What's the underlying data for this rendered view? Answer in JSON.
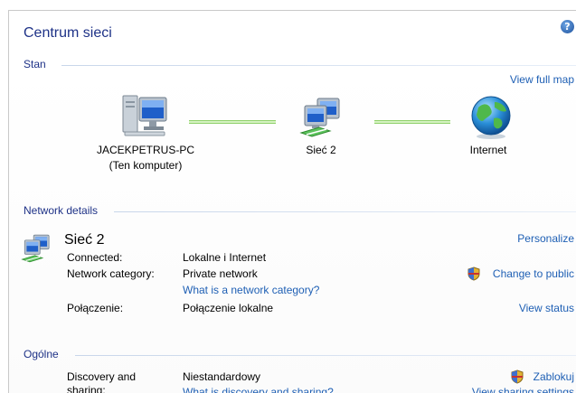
{
  "window": {
    "title": "Centrum sieci",
    "help_label": "?"
  },
  "status_section": {
    "heading": "Stan",
    "view_full_map": "View full map",
    "nodes": [
      {
        "name": "JACEKPETRUS-PC",
        "subtitle": "(Ten komputer)",
        "icon": "computer-icon"
      },
      {
        "name": "Sieć 2",
        "subtitle": "",
        "icon": "network-icon"
      },
      {
        "name": "Internet",
        "subtitle": "",
        "icon": "globe-icon"
      }
    ],
    "connection_color": "#8fd06a"
  },
  "network_details": {
    "heading": "Network details",
    "network_name": "Sieć 2",
    "personalize": "Personalize",
    "rows": [
      {
        "label": "Connected:",
        "value": "Lokalne i Internet"
      },
      {
        "label": "Network category:",
        "value": "Private network",
        "link": "What is a network category?",
        "action": "Change to public"
      },
      {
        "label": "Połączenie:",
        "value": "Połączenie lokalne",
        "action": "View status"
      }
    ]
  },
  "general_section": {
    "heading": "Ogólne",
    "rows": [
      {
        "label": "Discovery and sharing:",
        "value": "Niestandardowy",
        "link": "What is discovery and sharing?",
        "action": "Zablokuj",
        "action2": "View sharing settings"
      }
    ]
  },
  "colors": {
    "heading_blue": "#1e3287",
    "link_blue": "#1e5fb4"
  }
}
